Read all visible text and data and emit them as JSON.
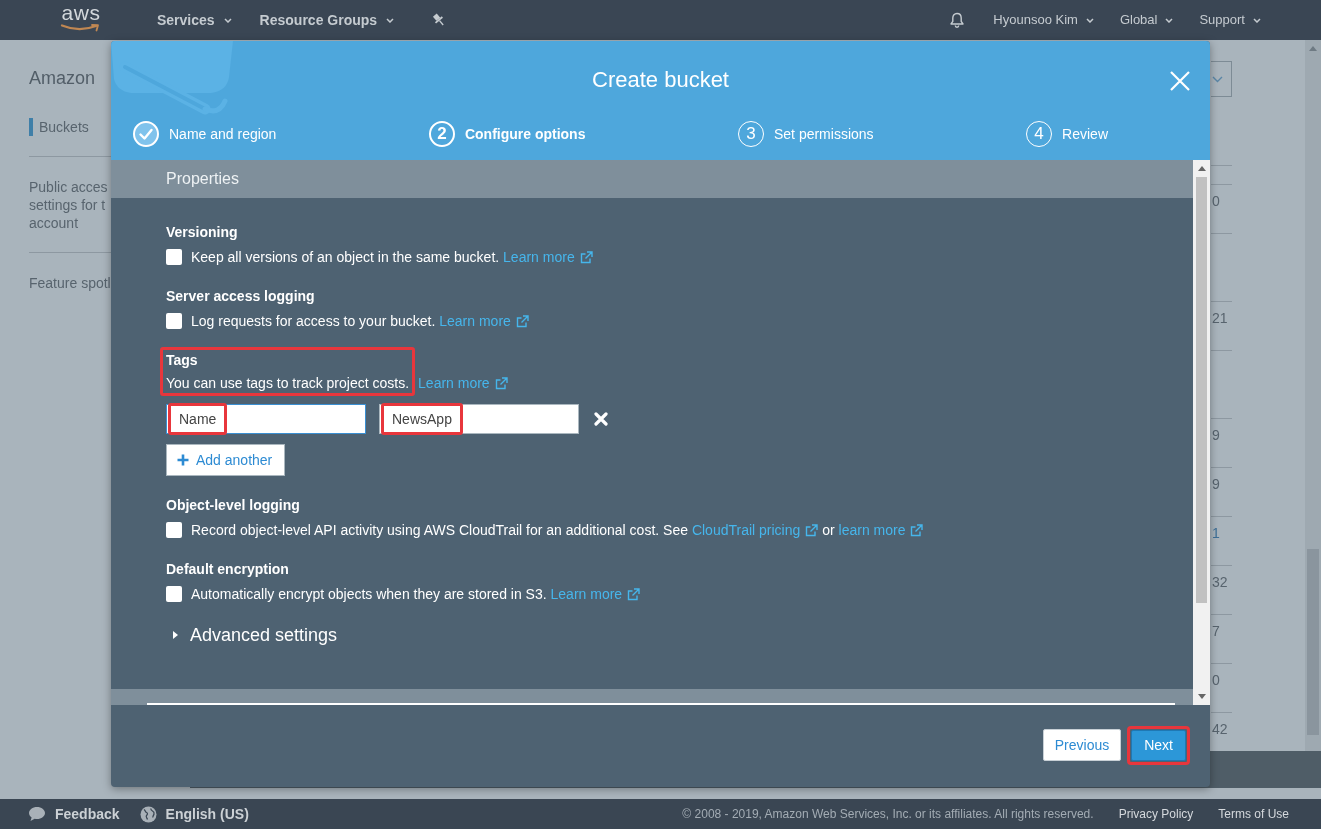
{
  "nav": {
    "logo": "aws",
    "menus": [
      {
        "label": "Services"
      },
      {
        "label": "Resource Groups"
      }
    ],
    "account_menus": [
      {
        "label": "Hyounsoo Kim"
      },
      {
        "label": "Global"
      },
      {
        "label": "Support"
      }
    ]
  },
  "sidebar": {
    "title": "Amazon",
    "items": [
      {
        "label": "Buckets",
        "selected": true
      },
      {
        "label": "Public acces\nsettings for t\naccount",
        "selected": false
      },
      {
        "label": "Feature spotl",
        "selected": false
      }
    ]
  },
  "table": {
    "rows": [
      {
        "kind": "text",
        "cell": "0"
      },
      {
        "kind": "blank"
      },
      {
        "kind": "text",
        "cell": "21"
      },
      {
        "kind": "blank"
      },
      {
        "kind": "text",
        "cell": "9"
      },
      {
        "kind": "text",
        "cell": "9"
      },
      {
        "kind": "link",
        "cell": "1"
      },
      {
        "kind": "text",
        "cell": "32"
      },
      {
        "kind": "text",
        "cell": "7"
      },
      {
        "kind": "text",
        "cell": "0"
      },
      {
        "kind": "text",
        "cell": "42"
      }
    ]
  },
  "dialog": {
    "title": "Create bucket",
    "steps": [
      {
        "label": "Name and region",
        "completed": true,
        "selected": false
      },
      {
        "number": "2",
        "label": "Configure options",
        "completed": false,
        "selected": true
      },
      {
        "number": "3",
        "label": "Set permissions",
        "completed": false,
        "selected": false
      },
      {
        "number": "4",
        "label": "Review",
        "completed": false,
        "selected": false
      }
    ],
    "section_title": "Properties",
    "options": [
      {
        "kind": "checkbox",
        "title": "Versioning",
        "checked": false,
        "parts": [
          {
            "kind": "text",
            "text": "Keep all versions of an object in the same bucket."
          },
          {
            "kind": "link",
            "text": "Learn more"
          }
        ]
      },
      {
        "kind": "checkbox",
        "title": "Server access logging",
        "checked": false,
        "parts": [
          {
            "kind": "text",
            "text": "Log requests for access to your bucket."
          },
          {
            "kind": "link",
            "text": "Learn more"
          }
        ]
      },
      {
        "kind": "tags",
        "title": "Tags",
        "highlighted": true,
        "description": "You can use tags to track project costs.",
        "link": "Learn more",
        "tags": [
          {
            "key": {
              "text": "Name",
              "focused": true,
              "highlighted": true
            },
            "value": {
              "text": "NewsApp",
              "focused": false,
              "highlighted": true
            }
          }
        ],
        "add_label": "Add another"
      },
      {
        "kind": "checkbox",
        "title": "Object-level logging",
        "checked": false,
        "parts": [
          {
            "kind": "text",
            "text": "Record object-level API activity using AWS CloudTrail for an additional cost. See"
          },
          {
            "kind": "link",
            "text": "CloudTrail pricing"
          },
          {
            "kind": "text",
            "text": "or"
          },
          {
            "kind": "link",
            "text": "learn more"
          }
        ]
      },
      {
        "kind": "checkbox",
        "title": "Default encryption",
        "checked": false,
        "parts": [
          {
            "kind": "text",
            "text": "Automatically encrypt objects when they are stored in S3."
          },
          {
            "kind": "link",
            "text": "Learn more"
          }
        ]
      }
    ],
    "advanced": {
      "label": "Advanced settings",
      "expanded": false
    },
    "buttons": [
      {
        "label": "Previous",
        "kind": "secondary",
        "highlighted": false
      },
      {
        "label": "Next",
        "kind": "primary",
        "highlighted": true
      }
    ]
  },
  "footer": {
    "feedback": "Feedback",
    "language": "English (US)",
    "copyright": "© 2008 - 2019, Amazon Web Services, Inc. or its affiliates. All rights reserved.",
    "links": [
      "Privacy Policy",
      "Terms of Use"
    ]
  }
}
